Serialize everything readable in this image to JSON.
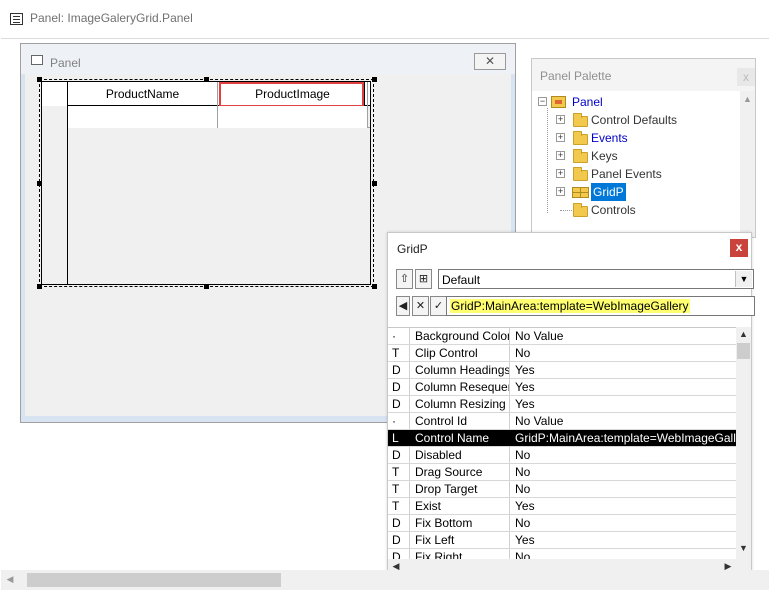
{
  "main_window": {
    "title": "Panel: ImageGaleryGrid.Panel"
  },
  "panel": {
    "title": "Panel",
    "close_glyph": "✕",
    "grid": {
      "headers": [
        "ProductName",
        "ProductImage"
      ],
      "highlighted_header": "ProductImage",
      "highlight_color": "#e04040"
    }
  },
  "palette": {
    "title": "Panel Palette",
    "close_glyph": "x",
    "tree": [
      {
        "label": "Panel",
        "level": 0,
        "expander": "−",
        "icon": "panel-icon",
        "color": "blue"
      },
      {
        "label": "Control Defaults",
        "level": 1,
        "expander": "+",
        "icon": "folder-icon",
        "color": "gray"
      },
      {
        "label": "Events",
        "level": 1,
        "expander": "+",
        "icon": "folder-icon",
        "color": "blue"
      },
      {
        "label": "Keys",
        "level": 1,
        "expander": "+",
        "icon": "folder-icon",
        "color": "gray"
      },
      {
        "label": "Panel Events",
        "level": 1,
        "expander": "+",
        "icon": "folder-icon",
        "color": "gray"
      },
      {
        "label": "GridP",
        "level": 1,
        "expander": "+",
        "icon": "grid-icon",
        "color": "selected"
      },
      {
        "label": "Controls",
        "level": 1,
        "expander": "",
        "icon": "folder-icon",
        "color": "gray"
      }
    ]
  },
  "properties": {
    "title": "GridP",
    "close_glyph": "x",
    "toolbar": {
      "up_glyph": "⇧",
      "tree_glyph": "⊞",
      "style_value": "Default",
      "dropdown_glyph": "▼"
    },
    "editrow": {
      "left_glyph": "◀",
      "cancel_glyph": "✕",
      "accept_glyph": "✓",
      "value": "GridP:MainArea:template=WebImageGallery"
    },
    "rows": [
      {
        "code": "·",
        "name": "Background Color",
        "value": "No Value"
      },
      {
        "code": "T",
        "name": "Clip Control",
        "value": "No"
      },
      {
        "code": "D",
        "name": "Column Headings",
        "value": "Yes"
      },
      {
        "code": "D",
        "name": "Column Resequen",
        "value": "Yes"
      },
      {
        "code": "D",
        "name": "Column Resizing",
        "value": "Yes"
      },
      {
        "code": "·",
        "name": "Control Id",
        "value": "No Value"
      },
      {
        "code": "L",
        "name": "Control Name",
        "value": "GridP:MainArea:template=WebImageGallery",
        "selected": true
      },
      {
        "code": "D",
        "name": "Disabled",
        "value": "No"
      },
      {
        "code": "T",
        "name": "Drag Source",
        "value": "No"
      },
      {
        "code": "T",
        "name": "Drop Target",
        "value": "No"
      },
      {
        "code": "T",
        "name": "Exist",
        "value": "Yes"
      },
      {
        "code": "D",
        "name": "Fix Bottom",
        "value": "No"
      },
      {
        "code": "D",
        "name": "Fix Left",
        "value": "Yes"
      },
      {
        "code": "D",
        "name": "Fix Right",
        "value": "No"
      }
    ],
    "scroll_glyphs": {
      "up": "▲",
      "down": "▼",
      "left": "◀",
      "right": "▶"
    }
  },
  "main_scroll": {
    "left_glyph": "◀"
  }
}
